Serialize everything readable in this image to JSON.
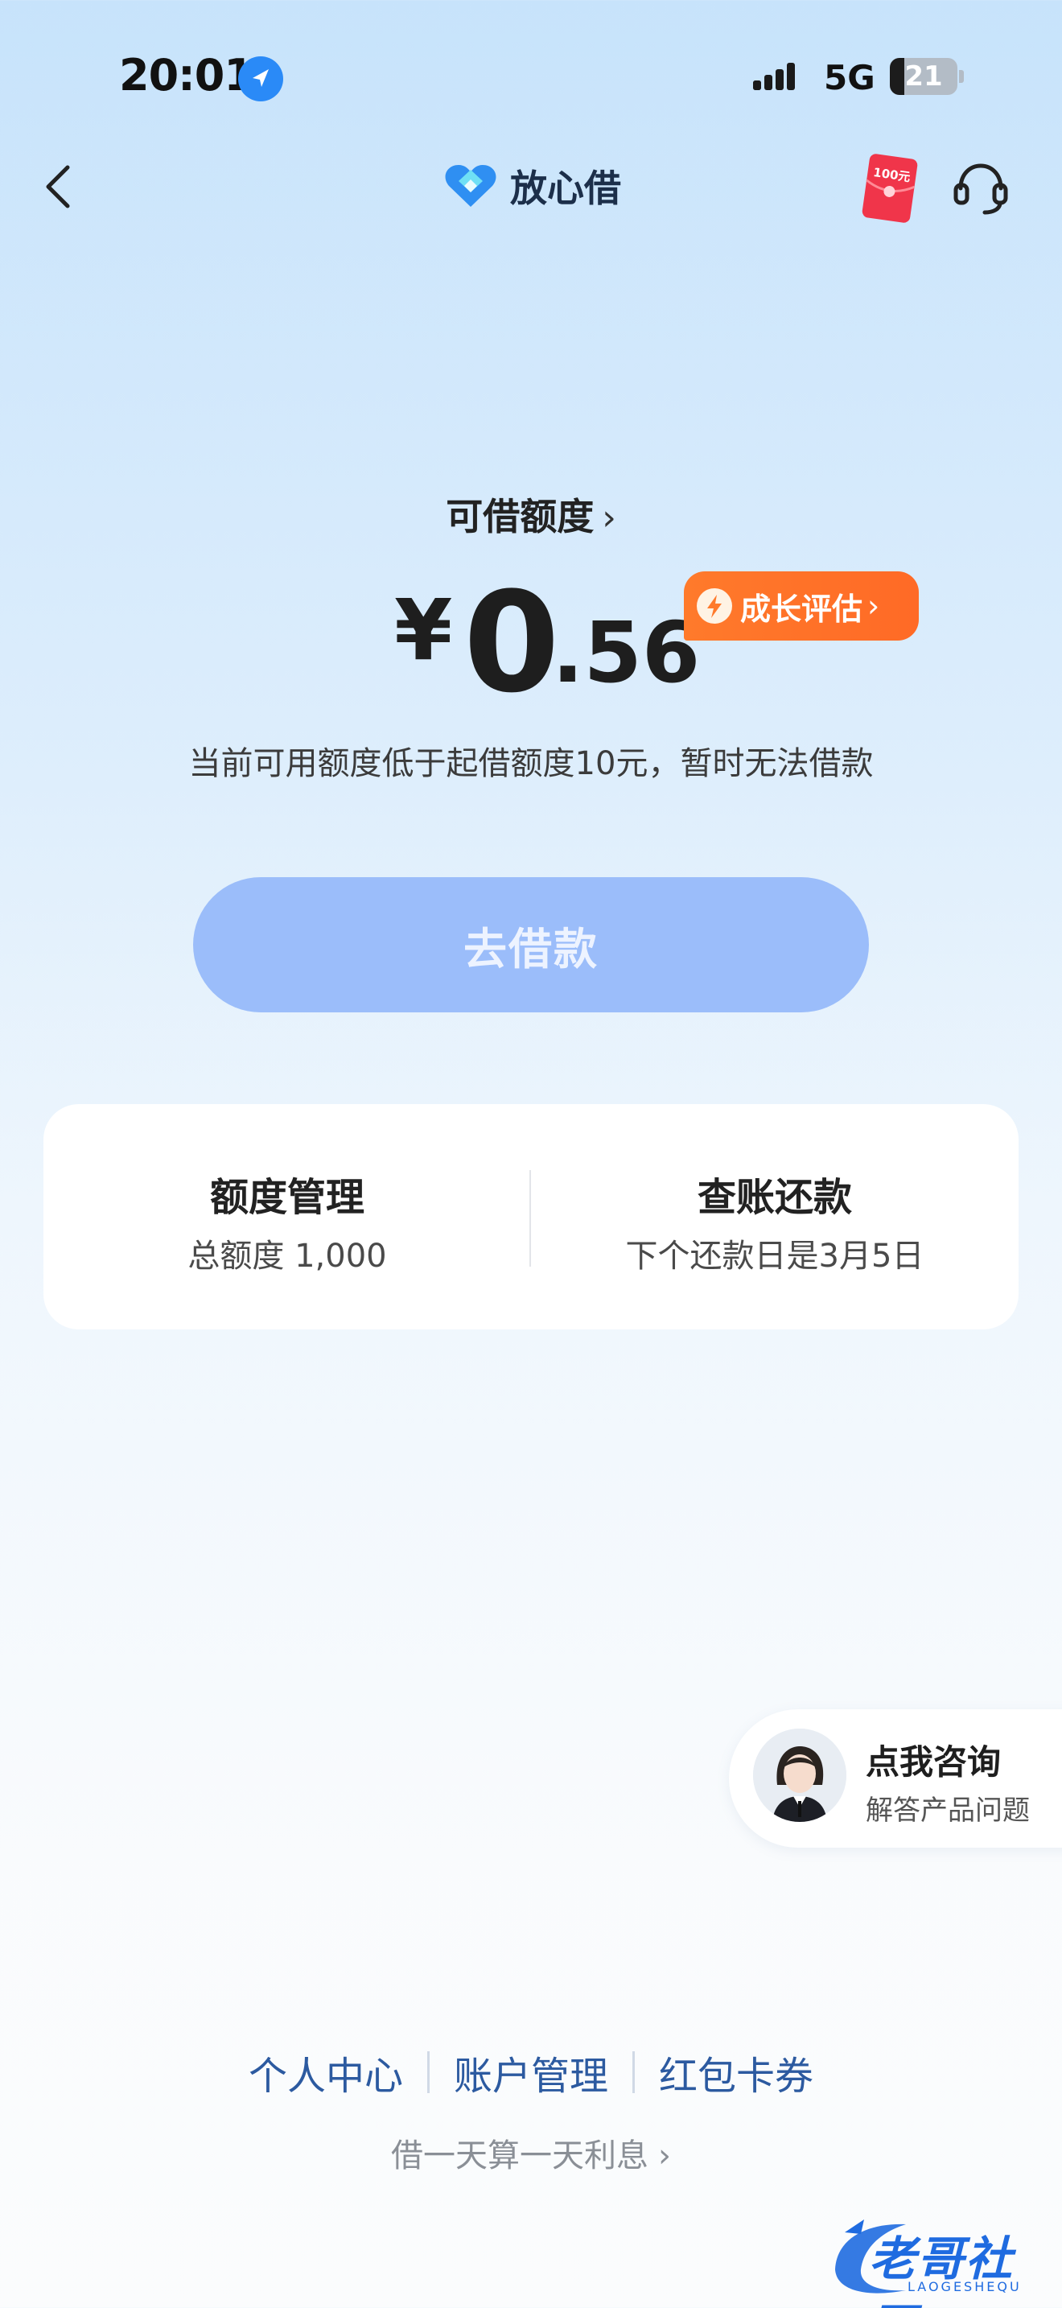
{
  "status_bar": {
    "time": "20:01",
    "network": "5G",
    "battery": "21",
    "battery_level": 0.21
  },
  "nav": {
    "brand_name": "放心借",
    "redpacket_label": "100元"
  },
  "credit": {
    "title": "可借额度",
    "currency": "¥",
    "amount_int": "0",
    "amount_dec": ".56",
    "growth_label": "成长评估",
    "notice": "当前可用额度低于起借额度10元，暂时无法借款"
  },
  "borrow_button": "去借款",
  "card": {
    "left": {
      "title": "额度管理",
      "sub": "总额度 1,000"
    },
    "right": {
      "title": "查账还款",
      "sub": "下个还款日是3月5日"
    }
  },
  "consult": {
    "title": "点我咨询",
    "sub": "解答产品问题"
  },
  "footer": {
    "links": [
      "个人中心",
      "账户管理",
      "红包卡券"
    ],
    "tagline": "借一天算一天利息"
  },
  "watermark": {
    "text": "老哥社区",
    "sub": "LAOGESHEQU"
  },
  "colors": {
    "accent": "#9bbdfa",
    "badge": "#ff6f28",
    "link": "#2c5aa0"
  }
}
